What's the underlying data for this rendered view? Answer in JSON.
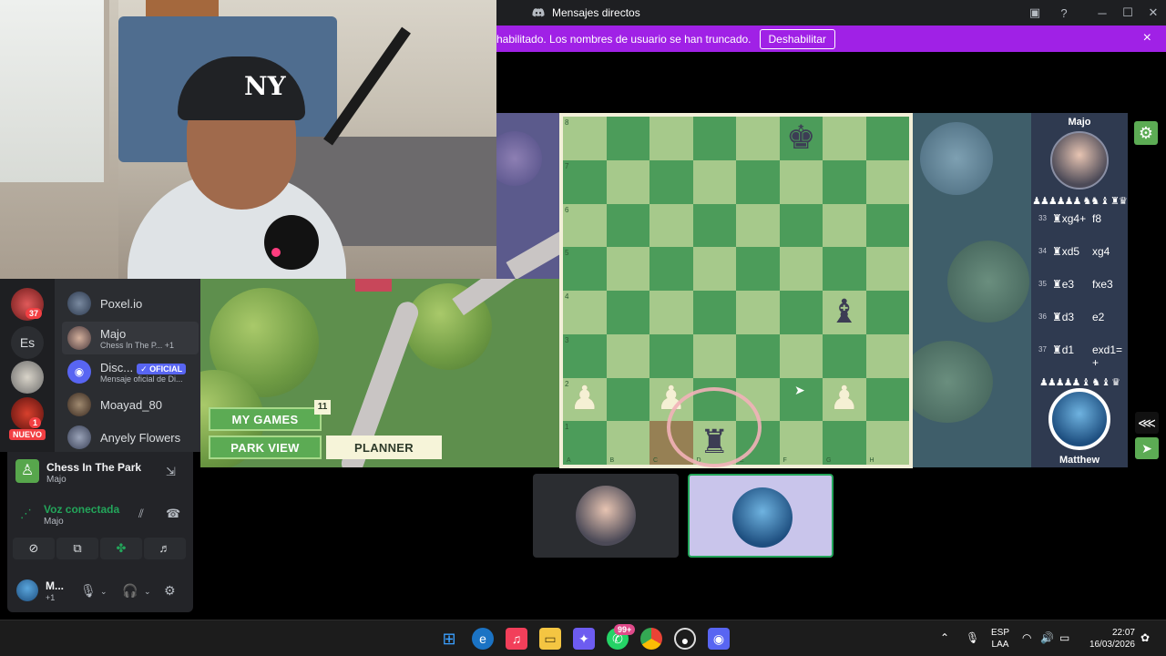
{
  "titlebar": {
    "title": "Mensajes directos"
  },
  "banner": {
    "text": "habilitado. Los nombres de usuario se han truncado.",
    "button": "Deshabilitar",
    "close_icon": "×"
  },
  "game": {
    "menu": {
      "my_games": "MY GAMES",
      "my_games_badge": "11",
      "park_view": "PARK VIEW",
      "planner": "PLANNER"
    },
    "board": {
      "ranks": [
        "8",
        "7",
        "6",
        "5",
        "4",
        "3",
        "2",
        "1"
      ],
      "files": [
        "A",
        "B",
        "C",
        "D",
        "E",
        "F",
        "G",
        "H"
      ]
    },
    "opponent": {
      "name": "Majo",
      "captured": "♟♟♟♟♟♟ ♞♞ ♝ ♜♛"
    },
    "player": {
      "name": "Matthew",
      "captured": "♟♟♟♟♟ ♝ ♞ ♝ ♛"
    },
    "moves": [
      {
        "num": "33",
        "white": "♜xg4+",
        "black": "f8"
      },
      {
        "num": "34",
        "white": "♜xd5",
        "black": "xg4"
      },
      {
        "num": "35",
        "white": "♜e3",
        "black": "fxe3"
      },
      {
        "num": "36",
        "white": "♜d3",
        "black": "e2"
      },
      {
        "num": "37",
        "white": "♜d1",
        "black": "exd1= +"
      }
    ]
  },
  "servers": {
    "badge_37": "37",
    "label_es": "Es",
    "badge_1": "1",
    "nuevo": "NUEVO"
  },
  "dms": [
    {
      "name": "Poxel.io",
      "sub": ""
    },
    {
      "name": "Majo",
      "sub": "Chess In The P...",
      "extra": "+1"
    },
    {
      "name": "Disc...",
      "sub": "Mensaje oficial de Di...",
      "badge": "✓ OFICIAL"
    },
    {
      "name": "Moayad_80",
      "sub": ""
    },
    {
      "name": "Anyely Flowers",
      "sub": ""
    }
  ],
  "voice": {
    "activity_title": "Chess In The Park",
    "activity_sub": "Majo",
    "status": "Voz conectada",
    "status_sub": "Majo",
    "user_name": "M...",
    "user_sub": "+1"
  },
  "taskbar": {
    "whatsapp_badge": "99+",
    "lang1": "ESP",
    "lang2": "LAA",
    "time": "22:07",
    "date": "16/03/2026"
  }
}
